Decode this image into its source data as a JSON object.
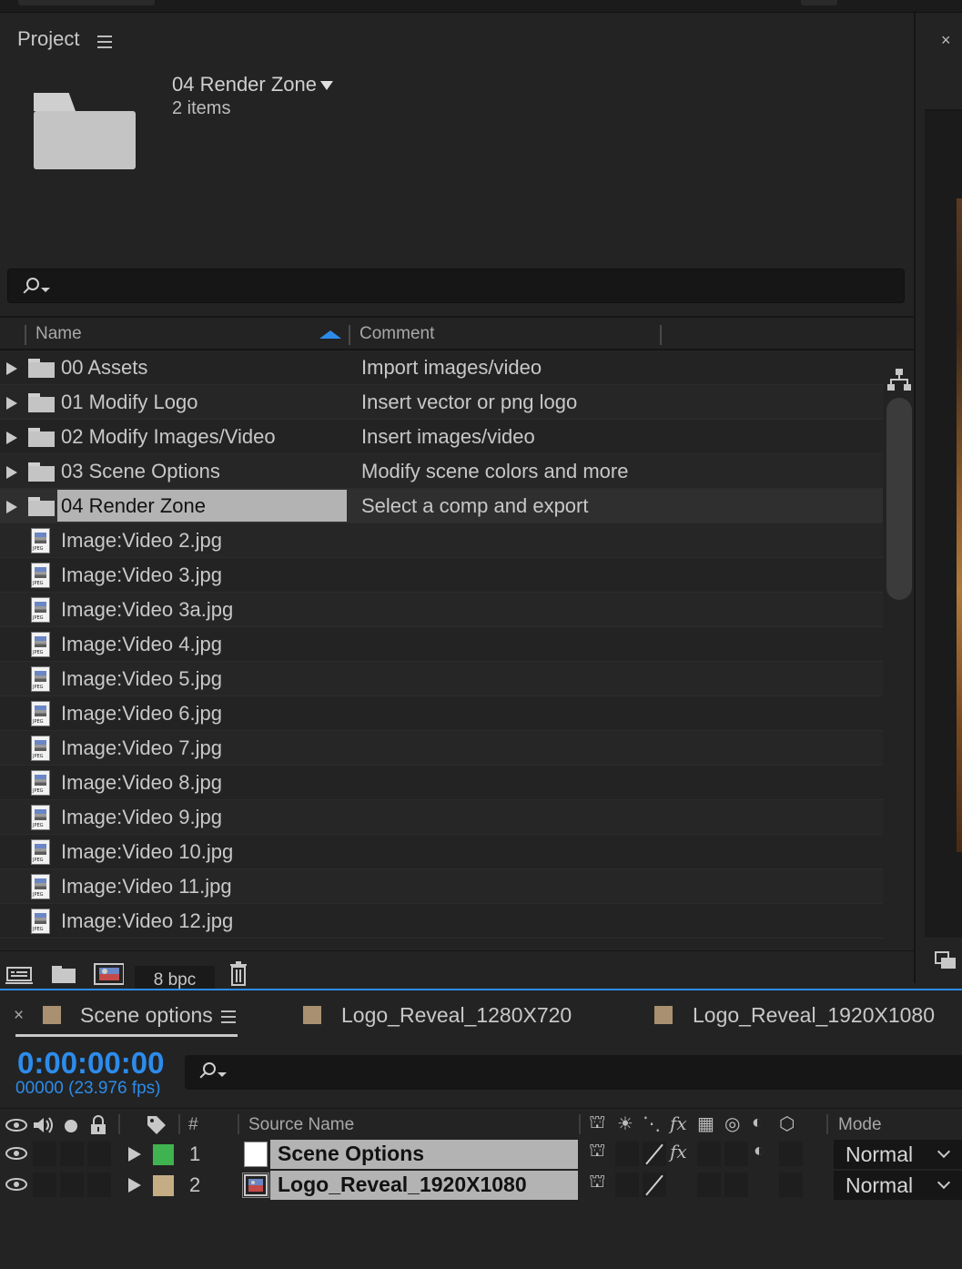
{
  "project_panel": {
    "title": "Project",
    "selected": {
      "name": "04 Render Zone",
      "count": "2 items"
    },
    "search": {
      "placeholder": ""
    },
    "columns": {
      "name": "Name",
      "comment": "Comment"
    },
    "items": [
      {
        "type": "folder",
        "name": "00 Assets",
        "comment": "Import images/video"
      },
      {
        "type": "folder",
        "name": "01 Modify Logo",
        "comment": "Insert vector or png logo"
      },
      {
        "type": "folder",
        "name": "02 Modify Images/Video",
        "comment": "Insert images/video"
      },
      {
        "type": "folder",
        "name": "03 Scene Options",
        "comment": "Modify scene colors and more"
      },
      {
        "type": "folder",
        "name": "04 Render Zone",
        "comment": "Select a comp and export",
        "selected": true
      },
      {
        "type": "jpeg",
        "name": "Image:Video 2.jpg",
        "comment": ""
      },
      {
        "type": "jpeg",
        "name": "Image:Video 3.jpg",
        "comment": ""
      },
      {
        "type": "jpeg",
        "name": "Image:Video 3a.jpg",
        "comment": ""
      },
      {
        "type": "jpeg",
        "name": "Image:Video 4.jpg",
        "comment": ""
      },
      {
        "type": "jpeg",
        "name": "Image:Video 5.jpg",
        "comment": ""
      },
      {
        "type": "jpeg",
        "name": "Image:Video 6.jpg",
        "comment": ""
      },
      {
        "type": "jpeg",
        "name": "Image:Video 7.jpg",
        "comment": ""
      },
      {
        "type": "jpeg",
        "name": "Image:Video 8.jpg",
        "comment": ""
      },
      {
        "type": "jpeg",
        "name": "Image:Video 9.jpg",
        "comment": ""
      },
      {
        "type": "jpeg",
        "name": "Image:Video 10.jpg",
        "comment": ""
      },
      {
        "type": "jpeg",
        "name": "Image:Video 11.jpg",
        "comment": ""
      },
      {
        "type": "jpeg",
        "name": "Image:Video 12.jpg",
        "comment": ""
      }
    ],
    "toolbar": {
      "bit_depth": "8 bpc"
    },
    "jpeg_tag": "JPEG"
  },
  "timeline": {
    "tabs": [
      {
        "label": "Scene options",
        "color": "#a89070",
        "active": true
      },
      {
        "label": "Logo_Reveal_1280X720",
        "color": "#a89070",
        "active": false
      },
      {
        "label": "Logo_Reveal_1920X1080",
        "color": "#a89070",
        "active": false
      }
    ],
    "timecode": "0:00:00:00",
    "frames": "00000 (23.976 fps)",
    "headers": {
      "number": "#",
      "source_name": "Source Name",
      "mode": "Mode"
    },
    "layers": [
      {
        "index": "1",
        "name": "Scene Options",
        "label_color": "#3fb34f",
        "mode": "Normal"
      },
      {
        "index": "2",
        "name": "Logo_Reveal_1920X1080",
        "label_color": "#c4ad84",
        "mode": "Normal"
      }
    ]
  },
  "colors": {
    "accent": "#2d8ceb",
    "panel_bg": "#232323"
  }
}
